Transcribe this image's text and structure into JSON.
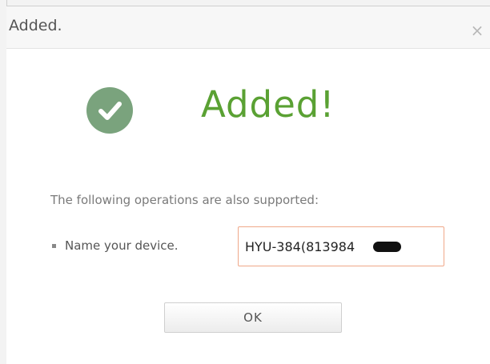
{
  "dialog": {
    "title": "Added.",
    "close_glyph": "×",
    "heading": "Added!",
    "success_icon": "checkmark-circle-icon",
    "accent_color": "#5aa133",
    "icon_color": "#7aa37d"
  },
  "operations": {
    "intro_text": "The following operations are also supported:",
    "name_label": "Name your device.",
    "device_name_value": "HYU-384(813984"
  },
  "buttons": {
    "ok_label": "OK"
  }
}
